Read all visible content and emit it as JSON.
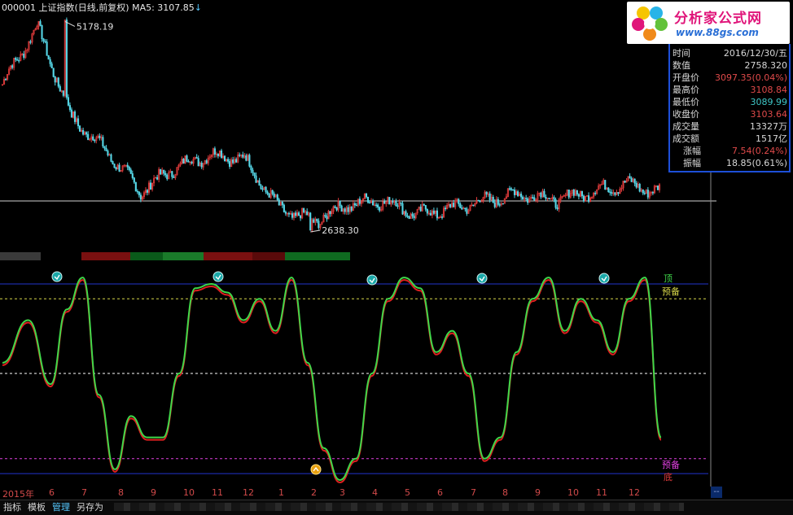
{
  "header": {
    "code_name": "000001 上证指数(日线,前复权)",
    "ma_label": "MA5: 3107.85",
    "ma_arrow": "↓"
  },
  "logo": {
    "title": "分析家公式网",
    "url": "www.88gs.com"
  },
  "info_panel": {
    "rows": [
      {
        "label": "时间",
        "value": "2016/12/30/五",
        "color": "#d8d8d8"
      },
      {
        "label": "数值",
        "value": "2758.320",
        "color": "#d8d8d8"
      },
      {
        "label": "开盘价",
        "value": "3097.35(0.04%)",
        "color": "#e04a4a"
      },
      {
        "label": "最高价",
        "value": "3108.84",
        "color": "#e04a4a"
      },
      {
        "label": "最低价",
        "value": "3089.99",
        "color": "#3fc8c8"
      },
      {
        "label": "收盘价",
        "value": "3103.64",
        "color": "#e04a4a"
      },
      {
        "label": "成交量",
        "value": "13327万",
        "color": "#d8d8d8"
      },
      {
        "label": "成交额",
        "value": "1517亿",
        "color": "#d8d8d8"
      },
      {
        "label": "涨幅",
        "value": "7.54(0.24%)",
        "color": "#e04a4a"
      },
      {
        "label": "振幅",
        "value": "18.85(0.61%)",
        "color": "#d8d8d8"
      }
    ]
  },
  "price_chart": {
    "high_label": "5178.19",
    "low_label": "2638.30"
  },
  "osc_labels": {
    "top": "顶",
    "pre_top": "预备",
    "pre_bottom": "预备",
    "bottom": "底"
  },
  "x_axis": {
    "labels": [
      "2015年",
      "6",
      "7",
      "8",
      "9",
      "10",
      "11",
      "12",
      "1",
      "2",
      "3",
      "4",
      "5",
      "6",
      "7",
      "8",
      "9",
      "10",
      "11",
      "12"
    ]
  },
  "bottom_tabs": [
    "指标",
    "模板",
    "管理",
    "另存为"
  ],
  "right_indicator": "--",
  "colors": {
    "up": "#e03b3b",
    "down": "#56d8e8",
    "osc_green": "#3fd84a",
    "osc_red": "#e02020",
    "top_line": "#2233cc",
    "pre_top_line": "#d8d84a",
    "mid_line": "#ffffff",
    "pre_bottom_line": "#e040e0"
  },
  "chart_data": [
    {
      "type": "line",
      "name": "上证指数 日线",
      "x": [
        "2015-05",
        "2015-06",
        "2015-07",
        "2015-08",
        "2015-09",
        "2015-10",
        "2015-11",
        "2015-12",
        "2016-01",
        "2016-02",
        "2016-03",
        "2016-04",
        "2016-05",
        "2016-06",
        "2016-07",
        "2016-08",
        "2016-09",
        "2016-10",
        "2016-11",
        "2016-12"
      ],
      "values": [
        4400,
        5100,
        4000,
        3600,
        3100,
        3400,
        3550,
        3500,
        2900,
        2750,
        2950,
        3000,
        2830,
        2900,
        3000,
        3080,
        3010,
        3100,
        3200,
        3103
      ],
      "annotations": [
        {
          "label": "5178.19",
          "value": 5178.19
        },
        {
          "label": "2638.30",
          "value": 2638.3
        }
      ],
      "ylim": [
        2550,
        5300
      ]
    },
    {
      "type": "line",
      "name": "oscillator",
      "x": [
        0,
        8,
        15,
        20,
        25,
        30,
        35,
        40,
        45,
        50,
        55,
        60,
        65,
        70,
        75,
        80,
        85,
        90,
        95,
        100,
        105,
        110,
        115,
        120,
        125,
        130,
        135,
        140,
        145,
        150,
        155,
        160,
        165,
        170,
        175,
        180,
        185,
        190,
        195,
        200,
        205
      ],
      "values": [
        55,
        75,
        45,
        80,
        95,
        40,
        5,
        30,
        20,
        20,
        50,
        90,
        92,
        88,
        75,
        85,
        70,
        95,
        55,
        15,
        0,
        10,
        50,
        85,
        95,
        90,
        60,
        70,
        50,
        10,
        20,
        60,
        85,
        95,
        70,
        85,
        75,
        60,
        85,
        95,
        20
      ],
      "reference_lines": [
        92,
        85,
        50,
        10,
        3
      ],
      "ylim": [
        0,
        100
      ]
    }
  ]
}
